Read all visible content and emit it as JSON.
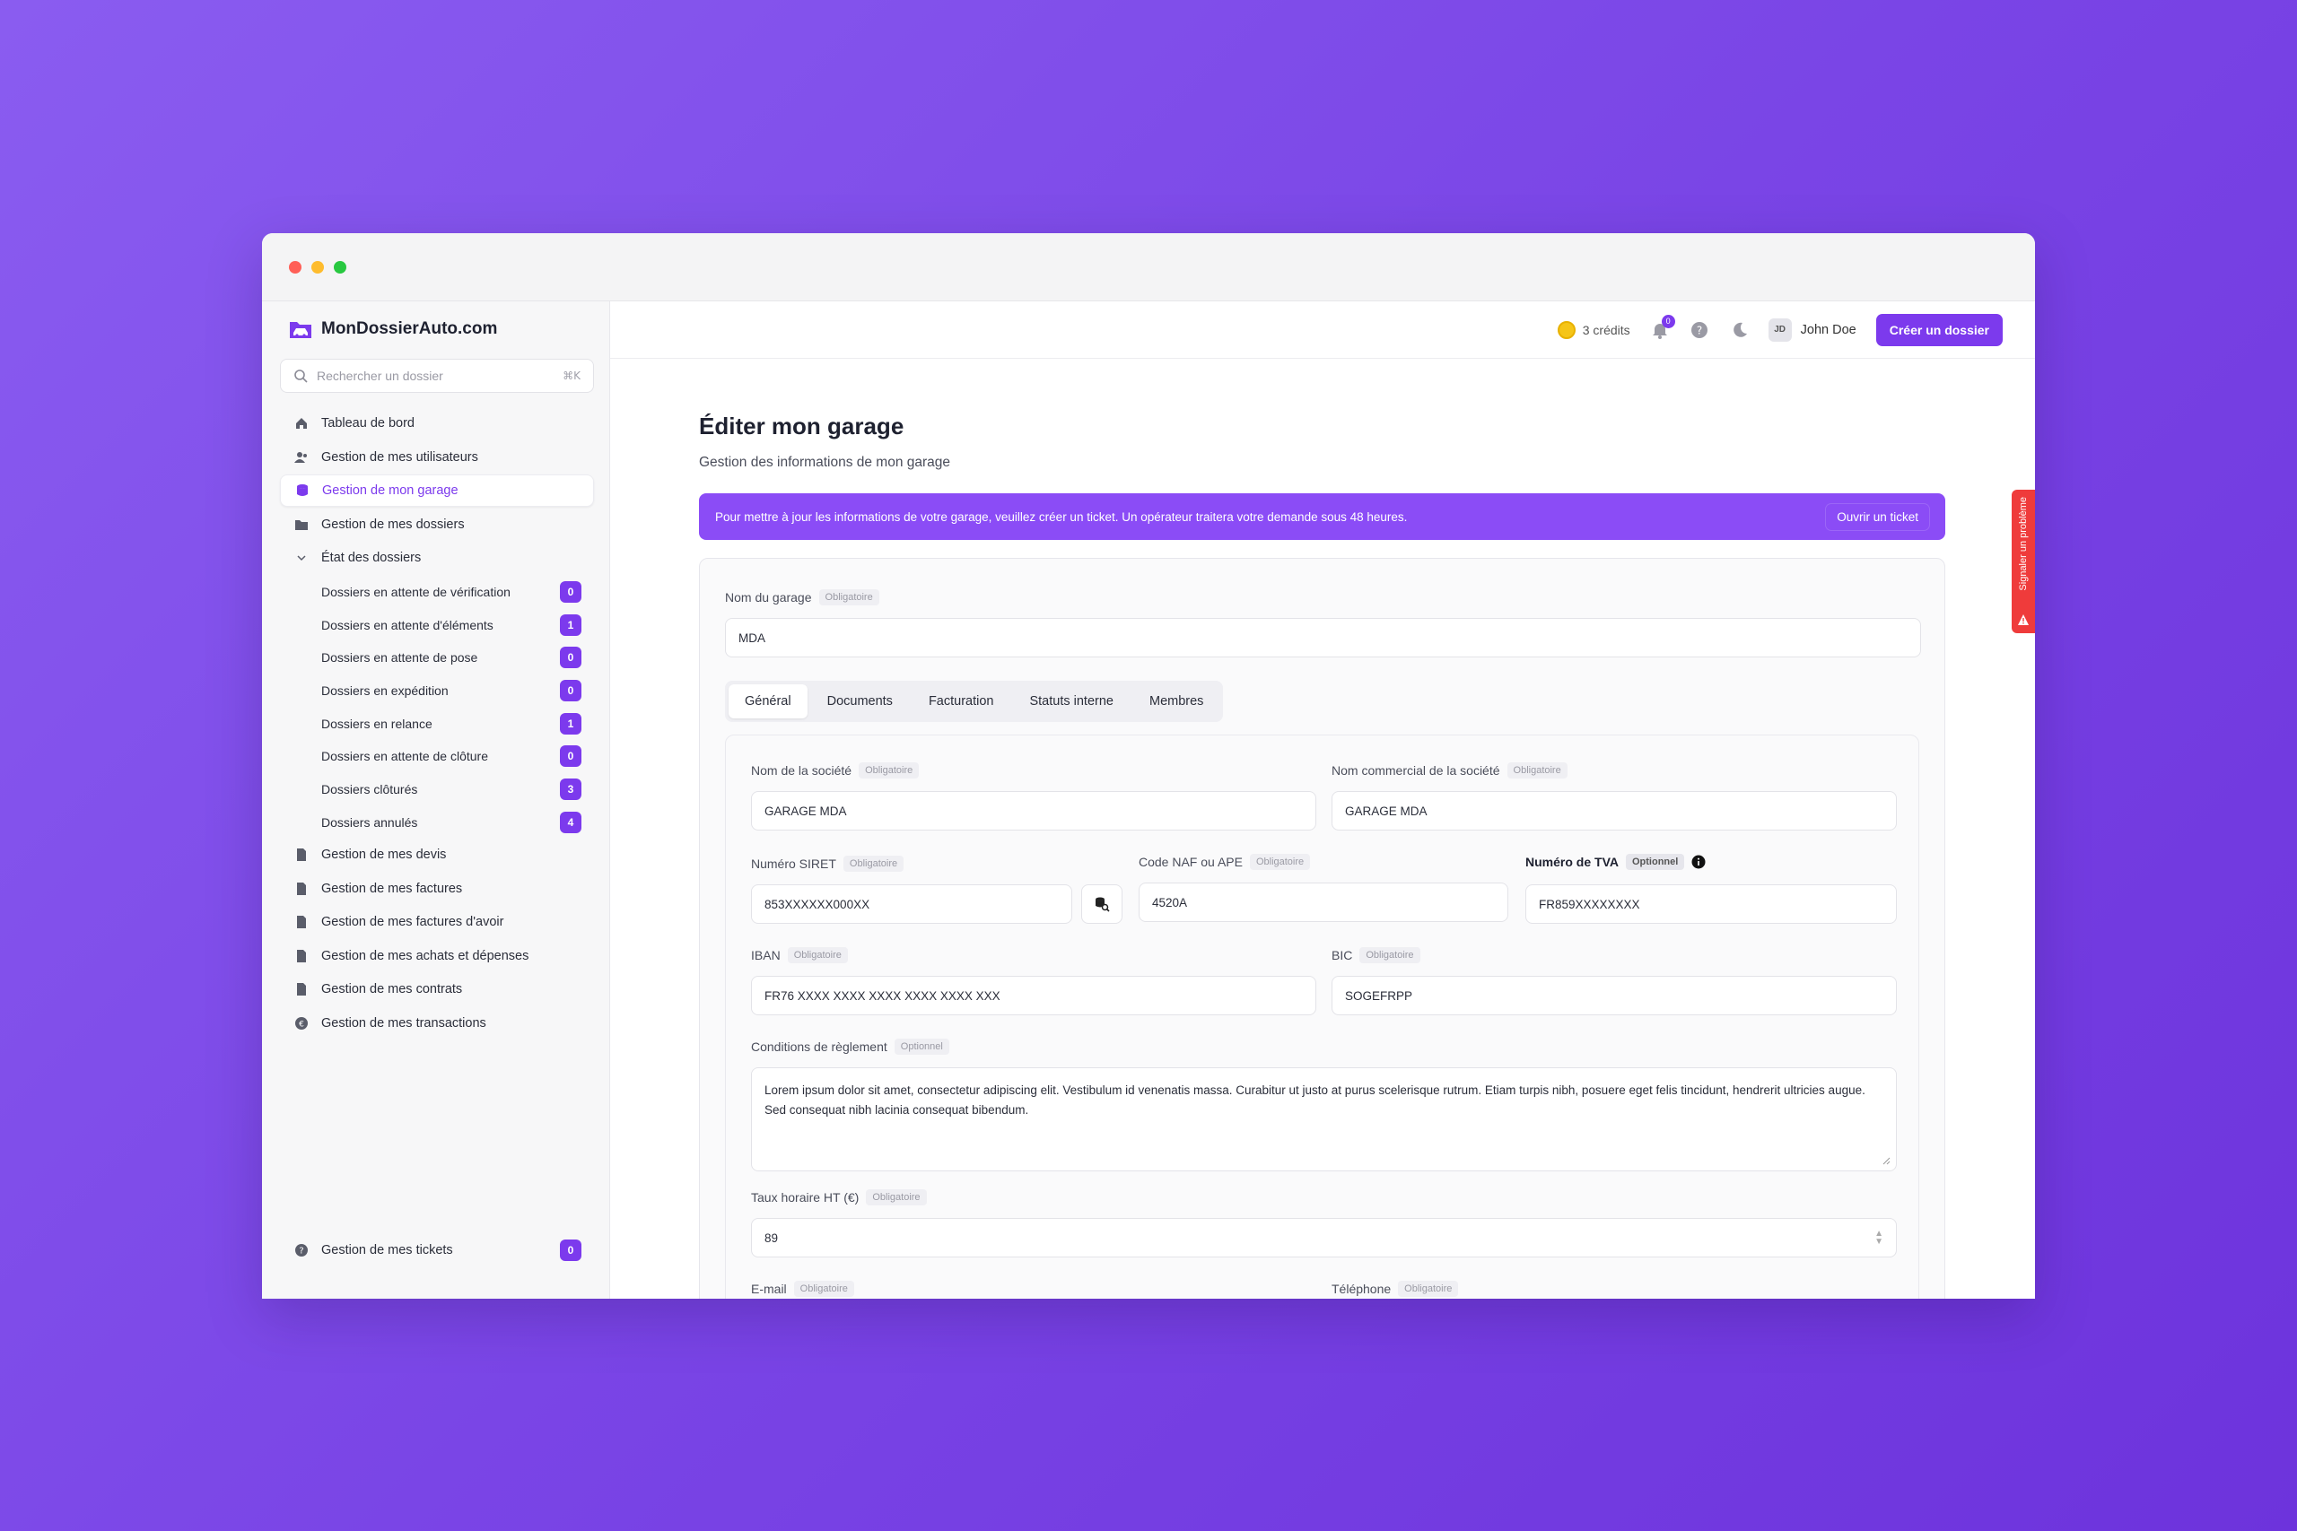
{
  "brand": {
    "name": "MonDossierAuto.com"
  },
  "search": {
    "placeholder": "Rechercher un dossier",
    "shortcut": "⌘K"
  },
  "sidebar": {
    "items": [
      {
        "label": "Tableau de bord",
        "icon": "home-icon"
      },
      {
        "label": "Gestion de mes utilisateurs",
        "icon": "users-icon"
      },
      {
        "label": "Gestion de mon garage",
        "icon": "database-icon",
        "active": true
      },
      {
        "label": "Gestion de mes dossiers",
        "icon": "folder-icon"
      },
      {
        "label": "État des dossiers",
        "icon": "chevron-down-icon"
      }
    ],
    "status_items": [
      {
        "label": "Dossiers en attente de vérification",
        "count": "0"
      },
      {
        "label": "Dossiers en attente d'éléments",
        "count": "1"
      },
      {
        "label": "Dossiers en attente de pose",
        "count": "0"
      },
      {
        "label": "Dossiers en expédition",
        "count": "0"
      },
      {
        "label": "Dossiers en relance",
        "count": "1"
      },
      {
        "label": "Dossiers en attente de clôture",
        "count": "0"
      },
      {
        "label": "Dossiers clôturés",
        "count": "3"
      },
      {
        "label": "Dossiers annulés",
        "count": "4"
      }
    ],
    "bottom_items": [
      {
        "label": "Gestion de mes devis",
        "icon": "document-icon"
      },
      {
        "label": "Gestion de mes factures",
        "icon": "document-icon"
      },
      {
        "label": "Gestion de mes factures d'avoir",
        "icon": "document-icon"
      },
      {
        "label": "Gestion de mes achats et dépenses",
        "icon": "document-icon"
      },
      {
        "label": "Gestion de mes contrats",
        "icon": "document-icon"
      },
      {
        "label": "Gestion de mes transactions",
        "icon": "currency-icon"
      }
    ],
    "tickets": {
      "label": "Gestion de mes tickets",
      "count": "0"
    }
  },
  "topbar": {
    "credits": "3 crédits",
    "notifications": "0",
    "user_initials": "JD",
    "user_name": "John Doe",
    "cta": "Créer un dossier"
  },
  "page": {
    "title": "Éditer mon garage",
    "subtitle": "Gestion des informations de mon garage",
    "banner_text": "Pour mettre à jour les informations de votre garage, veuillez créer un ticket. Un opérateur traitera votre demande sous 48 heures.",
    "banner_button": "Ouvrir un ticket"
  },
  "form": {
    "required": "Obligatoire",
    "optional": "Optionnel",
    "garage_name": {
      "label": "Nom du garage",
      "value": "MDA"
    },
    "tabs": [
      "Général",
      "Documents",
      "Facturation",
      "Statuts interne",
      "Membres"
    ],
    "company_name": {
      "label": "Nom de la société",
      "value": "GARAGE MDA"
    },
    "trade_name": {
      "label": "Nom commercial de la société",
      "value": "GARAGE MDA"
    },
    "siret": {
      "label": "Numéro SIRET",
      "value": "853XXXXXX000XX"
    },
    "naf": {
      "label": "Code NAF ou APE",
      "value": "4520A"
    },
    "tva": {
      "label": "Numéro de TVA",
      "value": "FR859XXXXXXXX"
    },
    "iban": {
      "label": "IBAN",
      "value": "FR76 XXXX XXXX XXXX XXXX XXXX XXX"
    },
    "bic": {
      "label": "BIC",
      "value": "SOGEFRPP"
    },
    "payment_terms": {
      "label": "Conditions de règlement",
      "value": "Lorem ipsum dolor sit amet, consectetur adipiscing elit. Vestibulum id venenatis massa. Curabitur ut justo at purus scelerisque rutrum. Etiam turpis nibh, posuere eget felis tincidunt, hendrerit ultricies augue. Sed consequat nibh lacinia consequat bibendum."
    },
    "hourly_rate": {
      "label": "Taux horaire HT (€)",
      "value": "89"
    },
    "email": {
      "label": "E-mail"
    },
    "phone": {
      "label": "Téléphone"
    }
  },
  "report": {
    "label": "Signaler un problème"
  },
  "colors": {
    "accent": "#7c3aed",
    "banner": "#8b4cf6",
    "report": "#ef3b3b"
  }
}
